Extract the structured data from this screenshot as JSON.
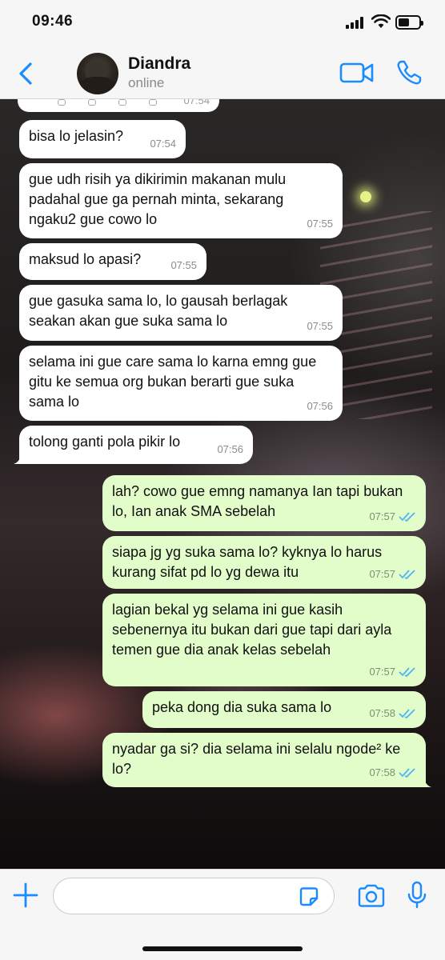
{
  "status_bar": {
    "time": "09:46",
    "battery_level": 0.4
  },
  "header": {
    "back_icon": "chevron-left-icon",
    "contact_name": "Diandra",
    "contact_status": "online",
    "video_icon": "video-camera-icon",
    "call_icon": "phone-icon"
  },
  "chat": {
    "partial_message_time": "07:54",
    "messages": [
      {
        "direction": "in",
        "text": "bisa lo jelasin?",
        "time": "07:54"
      },
      {
        "direction": "in",
        "text": "gue udh risih ya dikirimin makanan mulu padahal gue ga pernah minta, sekarang ngaku2 gue cowo lo",
        "time": "07:55"
      },
      {
        "direction": "in",
        "text": "maksud lo apasi?",
        "time": "07:55"
      },
      {
        "direction": "in",
        "text": "gue gasuka sama lo, lo gausah berlagak seakan akan gue suka sama lo",
        "time": "07:55"
      },
      {
        "direction": "in",
        "text": "selama ini gue care sama lo karna emng gue gitu ke semua org bukan berarti gue suka sama lo",
        "time": "07:56"
      },
      {
        "direction": "in",
        "text": "tolong ganti pola pikir lo",
        "time": "07:56"
      },
      {
        "direction": "out",
        "text": "lah? cowo gue emng namanya Ian tapi bukan lo, Ian anak SMA sebelah",
        "time": "07:57"
      },
      {
        "direction": "out",
        "text": "siapa jg yg suka sama lo? kyknya lo harus kurang sifat pd lo yg dewa itu",
        "time": "07:57"
      },
      {
        "direction": "out",
        "text": "lagian bekal yg selama ini gue kasih sebenernya itu bukan dari gue tapi dari ayla temen gue dia anak kelas sebelah",
        "time": "07:57"
      },
      {
        "direction": "out",
        "text": "peka dong dia suka sama lo",
        "time": "07:58"
      },
      {
        "direction": "out",
        "text": "nyadar ga si? dia selama ini selalu ngode² ke lo?",
        "time": "07:58"
      }
    ]
  },
  "input_bar": {
    "plus_icon": "plus-icon",
    "sticker_icon": "sticker-icon",
    "camera_icon": "camera-icon",
    "mic_icon": "microphone-icon",
    "placeholder": ""
  },
  "colors": {
    "accent": "#1a8cff",
    "outgoing_bubble": "#e2fdca",
    "incoming_bubble": "#ffffff",
    "read_ticks": "#4fb3f6"
  }
}
